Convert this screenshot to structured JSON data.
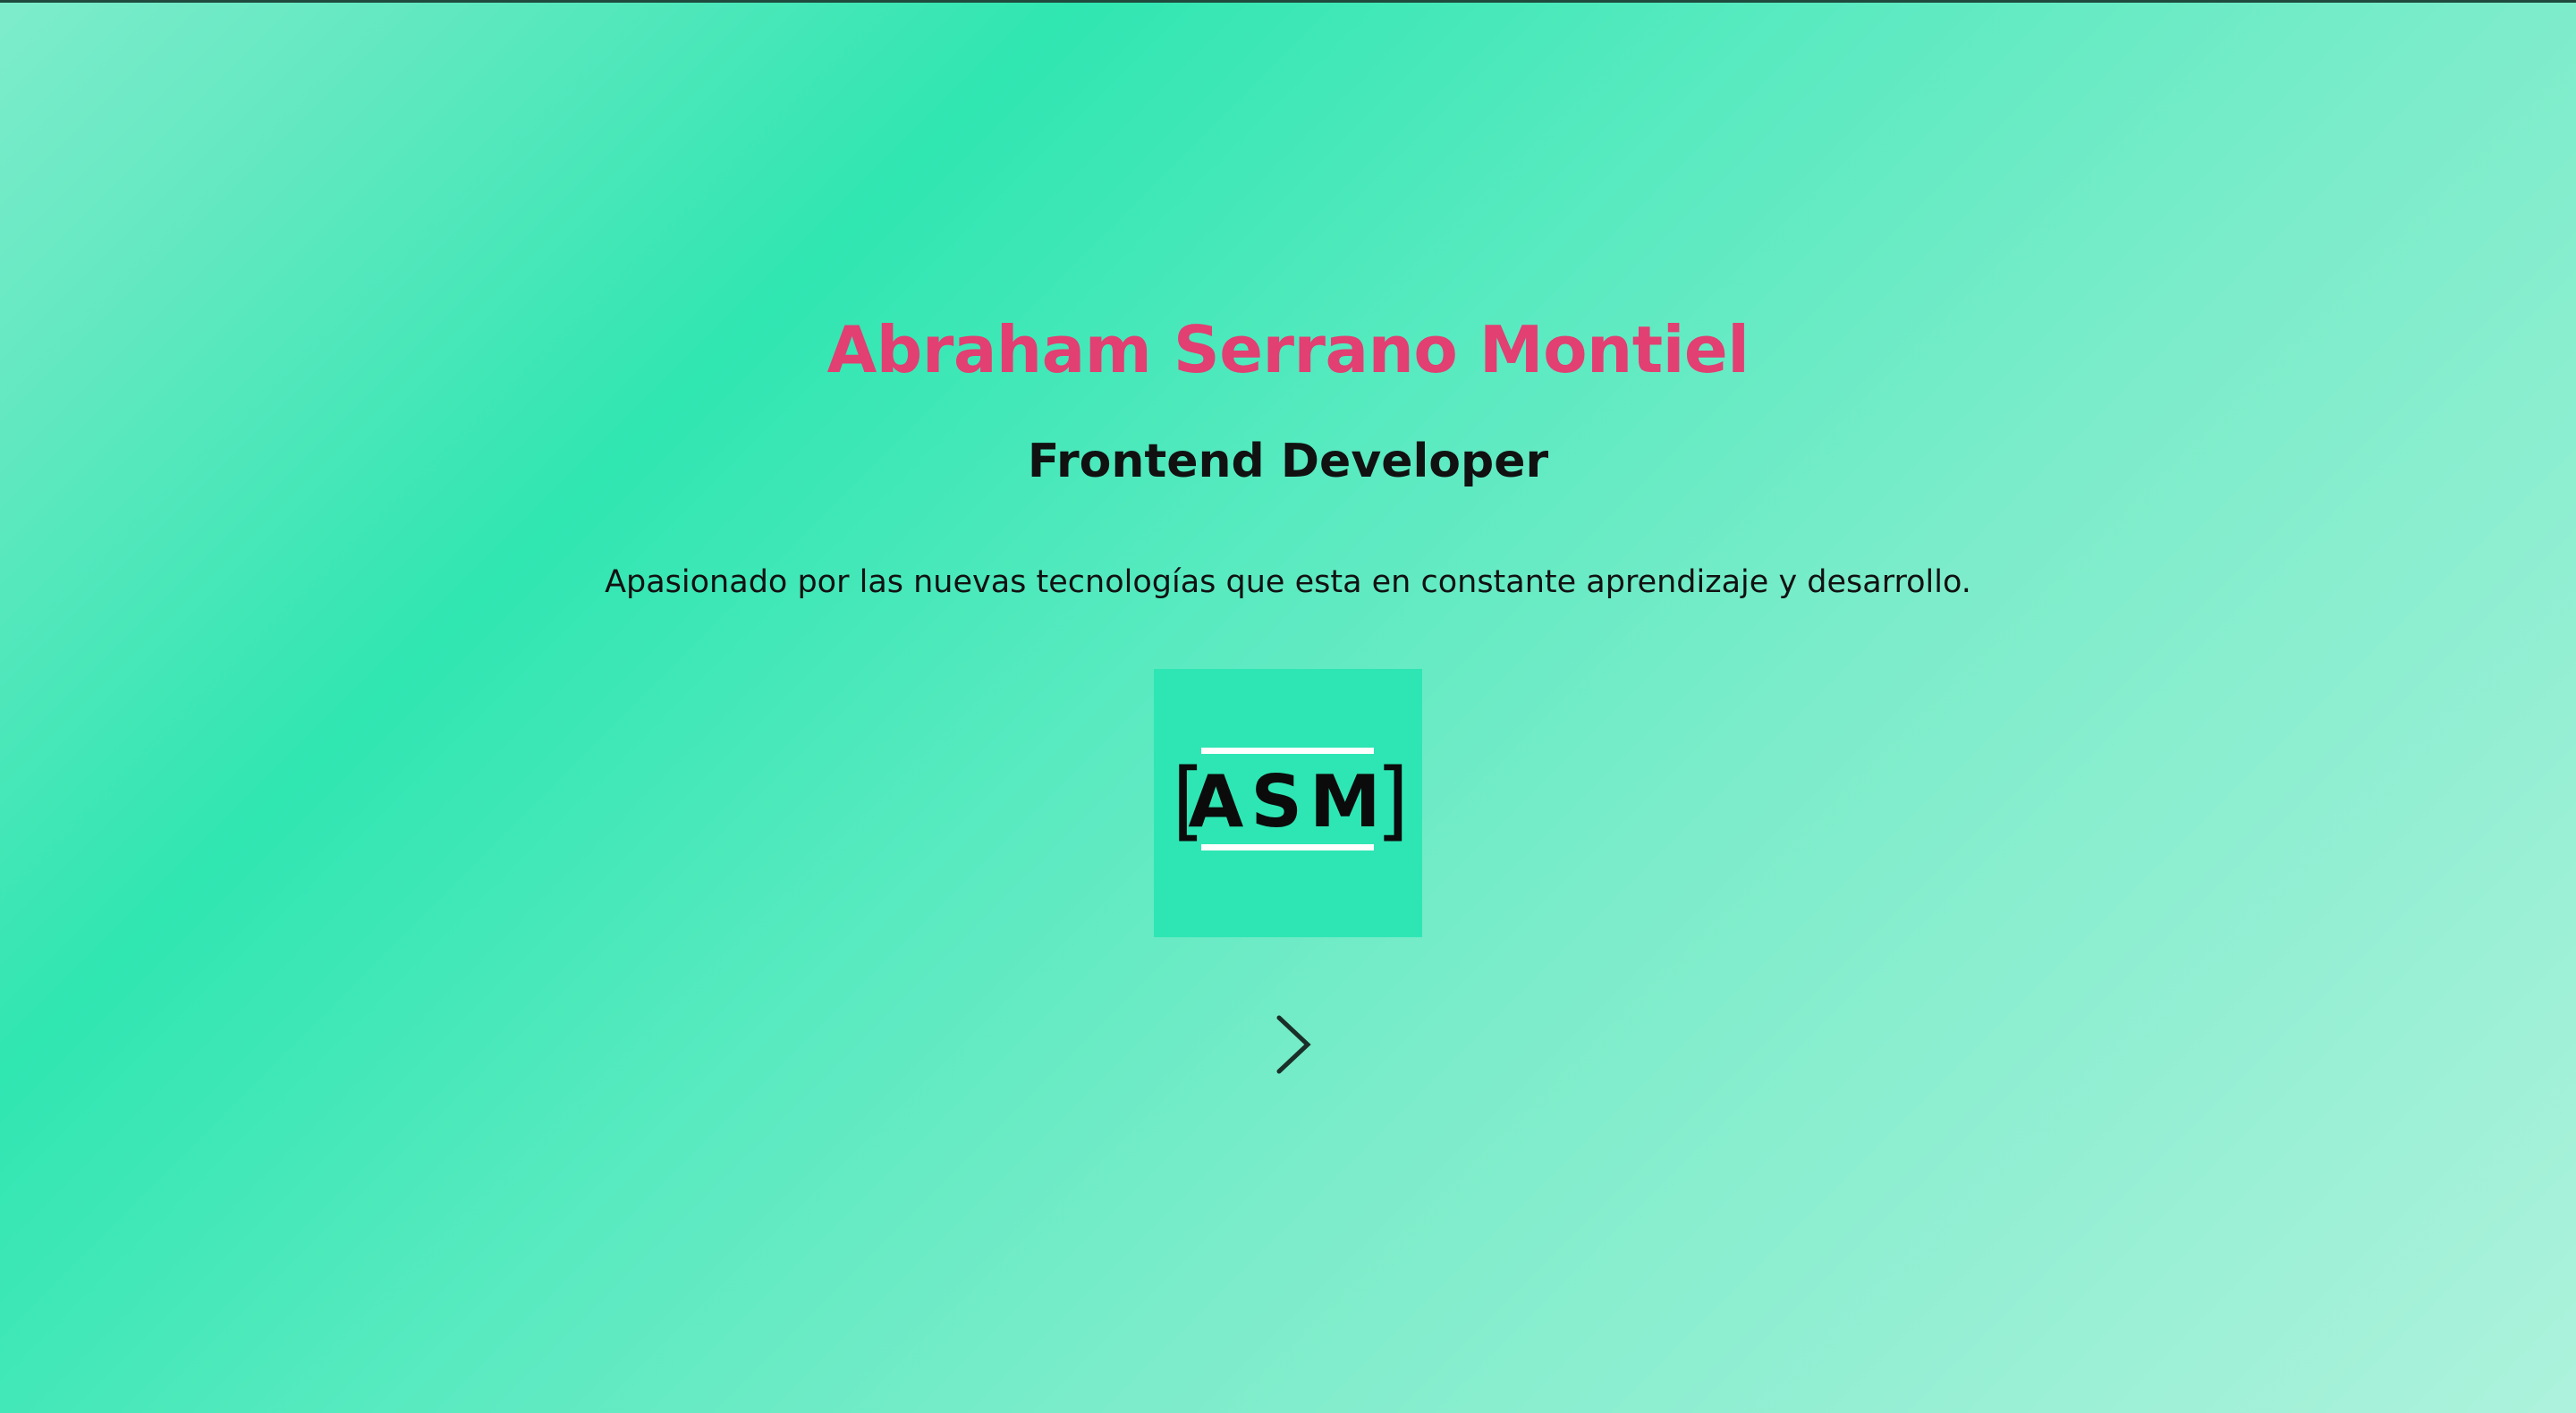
{
  "hero": {
    "name": "Abraham Serrano Montiel",
    "role": "Frontend Developer",
    "tagline": "Apasionado por las nuevas tecnologías que esta en constante aprendizaje y desarrollo."
  },
  "logo": {
    "text": "ASM",
    "open_bracket": "[",
    "close_bracket": "]"
  },
  "navigation": {
    "next_icon": "chevron-right-icon"
  },
  "colors": {
    "accent": "#e23f72",
    "text": "#111111",
    "logo_bg": "#2ee6b4",
    "gradient_mid": "#30e6b1",
    "gradient_light": "#adf2dc"
  }
}
